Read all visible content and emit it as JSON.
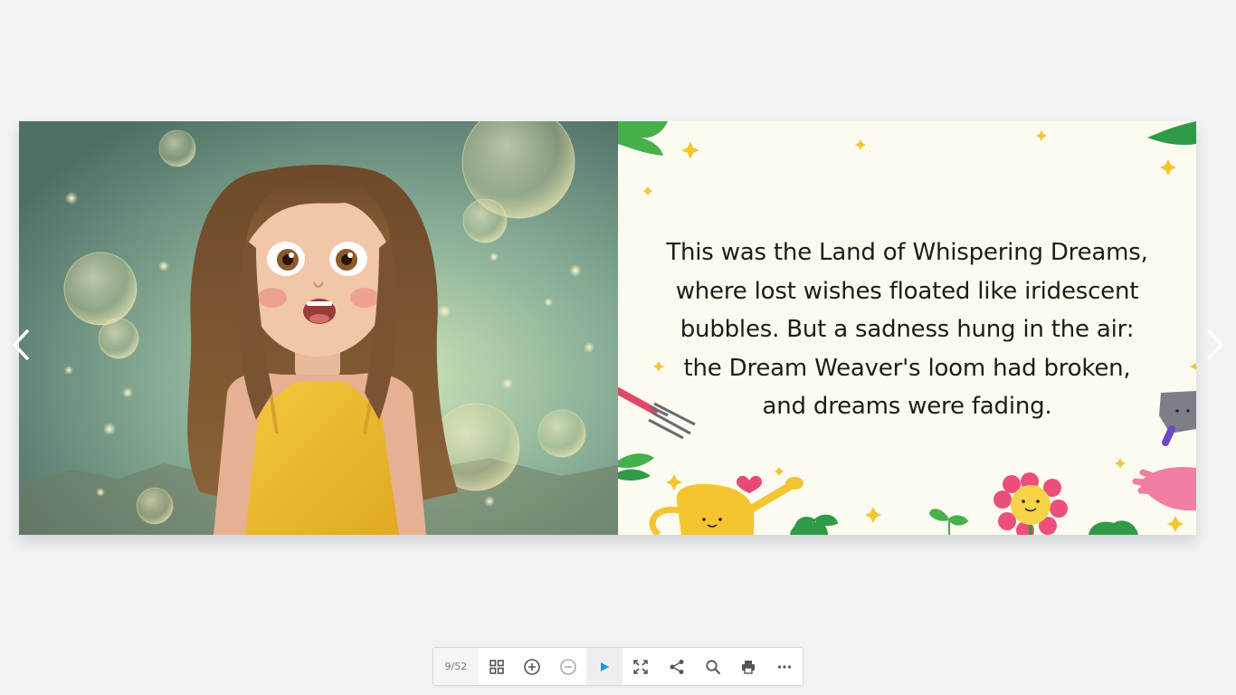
{
  "viewer": {
    "page_counter": "9/52"
  },
  "spread": {
    "right_page_text": "This was the Land of Whispering Dreams, where lost wishes floated like iridescent bubbles. But a sadness hung in the air: the Dream Weaver's loom had broken, and dreams were fading."
  },
  "toolbar": {
    "buttons": [
      {
        "name": "thumbnails-icon"
      },
      {
        "name": "zoom-in-icon"
      },
      {
        "name": "zoom-out-icon"
      },
      {
        "name": "play-icon"
      },
      {
        "name": "fullscreen-icon"
      },
      {
        "name": "share-icon"
      },
      {
        "name": "search-icon"
      },
      {
        "name": "print-icon"
      },
      {
        "name": "more-icon"
      }
    ]
  },
  "colors": {
    "accent": "#1a9bd7",
    "icon": "#555555",
    "background": "#f1f2f5",
    "page_right": "#fdfbf0"
  }
}
